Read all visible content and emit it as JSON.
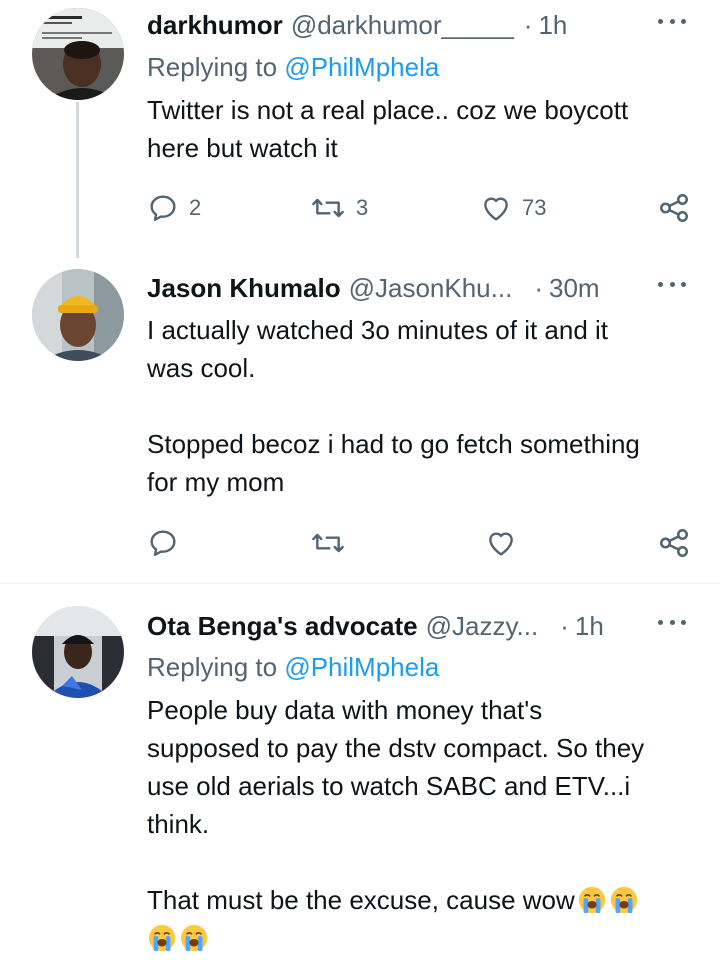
{
  "tweets": [
    {
      "name": "darkhumor",
      "handle": "@darkhumor_____",
      "dot": "·",
      "time": "1h",
      "replying_label": "Replying to",
      "replying_mention": "@PhilMphela",
      "text": "Twitter is not a real place.. coz we boycott\nhere but watch it",
      "reply_count": "2",
      "retweet_count": "3",
      "like_count": "73"
    },
    {
      "name": "Jason Khumalo",
      "handle": "@JasonKhu...",
      "dot": "·",
      "time": "30m",
      "text": "I actually watched 3o minutes of it and it\nwas cool.\n\nStopped becoz i had to go fetch something\nfor my mom"
    },
    {
      "name": "Ota Benga's advocate",
      "handle": "@Jazzy...",
      "dot": "·",
      "time": "1h",
      "replying_label": "Replying to",
      "replying_mention": "@PhilMphela",
      "text": "People buy data with money that's\nsupposed to pay the dstv compact. So they\nuse old aerials to watch SABC and ETV...i\nthink.\n\nThat must be the excuse, cause wow"
    }
  ],
  "icons": {
    "reply": "reply-icon",
    "retweet": "retweet-icon",
    "like": "heart-icon",
    "share": "share-icon",
    "more": "more-icon",
    "emoji": "loudly-crying-face-emoji"
  },
  "colors": {
    "text": "#0f1419",
    "secondary": "#536471",
    "link": "#1d9bf0",
    "divider": "#eff3f4",
    "thread_line": "#cfd9de"
  }
}
